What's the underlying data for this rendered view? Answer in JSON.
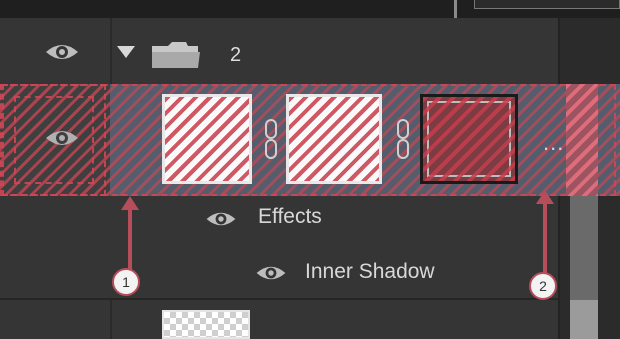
{
  "layers": {
    "group": {
      "name": "2",
      "eye_icon": "eye-icon",
      "toggle_icon": "disclosure-triangle-icon",
      "folder_icon": "folder-icon"
    },
    "selected_layer": {
      "eye_icon": "eye-icon",
      "link_icon": "chain-link-icon",
      "more_label": "..."
    },
    "effects": {
      "label": "Effects",
      "eye_icon": "eye-icon"
    },
    "inner_shadow": {
      "label": "Inner Shadow",
      "eye_icon": "eye-icon"
    }
  },
  "callouts": [
    {
      "number": "1"
    },
    {
      "number": "2"
    }
  ],
  "colors": {
    "panel_bg": "#353535",
    "selection": "#555d6c",
    "hatch": "#cd4655",
    "callout_arrow": "#b54d5b"
  }
}
